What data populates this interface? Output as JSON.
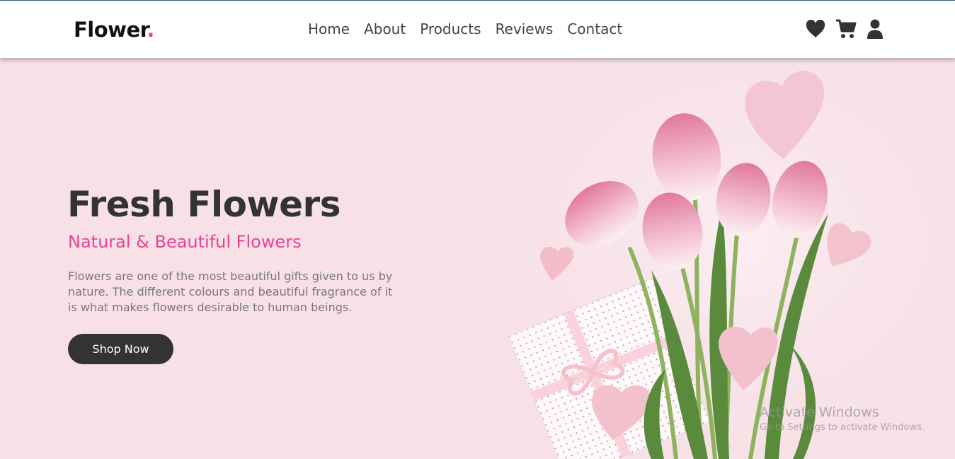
{
  "logo": {
    "text": "Flower",
    "dot": "."
  },
  "nav": {
    "items": [
      "Home",
      "About",
      "Products",
      "Reviews",
      "Contact"
    ]
  },
  "header_icons": [
    "heart-icon",
    "cart-icon",
    "user-icon"
  ],
  "hero": {
    "title": "Fresh Flowers",
    "subtitle": "Natural & Beautiful Flowers",
    "description": "Flowers are one of the most beautiful gifts given to us by nature. The different colours and beautiful fragrance of it is what makes flowers desirable to human beings.",
    "button": "Shop Now"
  },
  "watermark": {
    "title": "Activate Windows",
    "subtitle": "Go to Settings to activate Windows."
  },
  "colors": {
    "accent": "#e84393",
    "dark": "#333333",
    "background": "#f7e1e7",
    "header": "#ffffff"
  }
}
